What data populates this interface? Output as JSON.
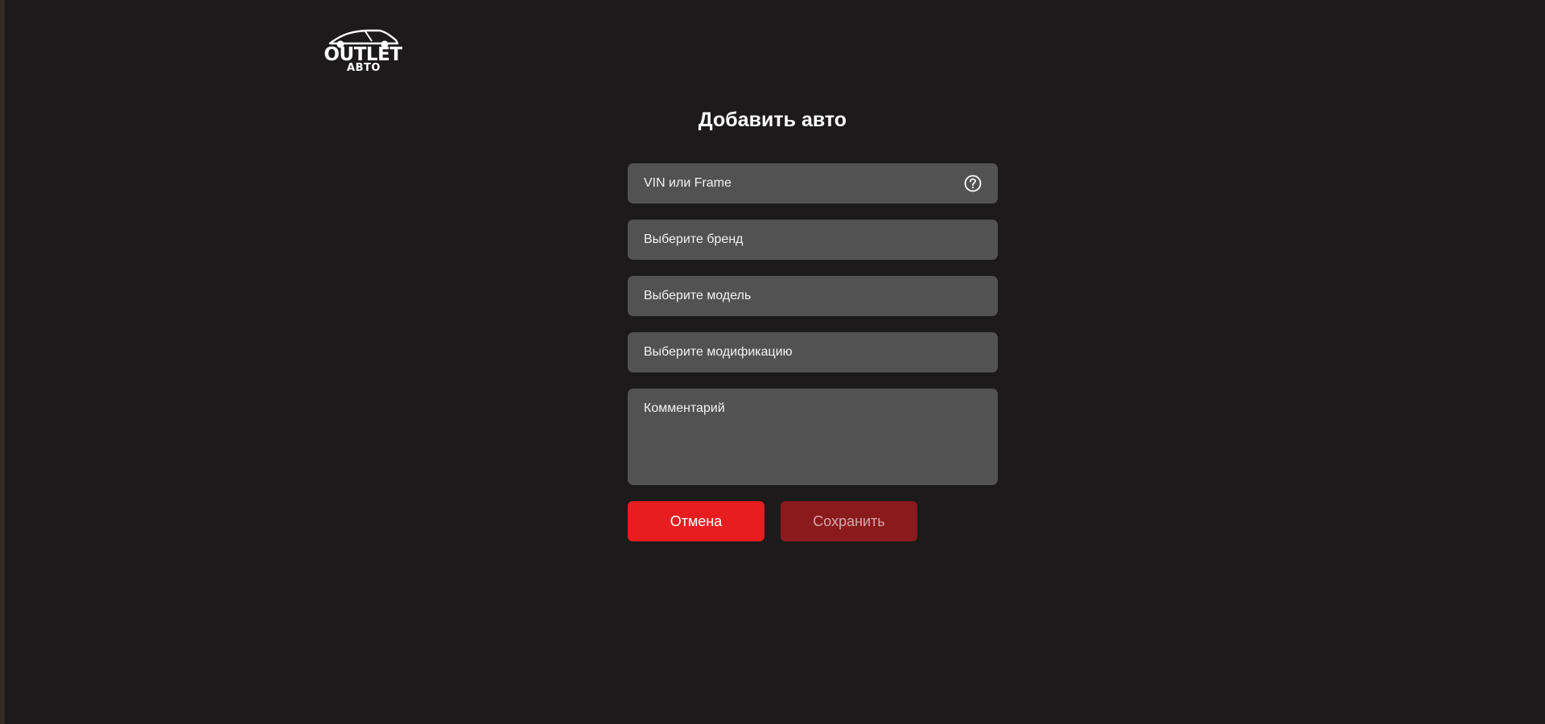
{
  "logo": {
    "line1": "OUTLET",
    "line2": "АВТО"
  },
  "form": {
    "title": "Добавить авто",
    "vin_placeholder": "VIN или Frame",
    "brand_placeholder": "Выберите бренд",
    "model_placeholder": "Выберите модель",
    "modification_placeholder": "Выберите модификацию",
    "comment_placeholder": "Комментарий",
    "help_icon": "question-circle-icon"
  },
  "buttons": {
    "cancel_label": "Отмена",
    "save_label": "Сохранить"
  },
  "colors": {
    "background": "#1c1a1b",
    "field": "#525252",
    "cancel": "#e71d1f",
    "save_disabled": "#8b1a1c"
  }
}
